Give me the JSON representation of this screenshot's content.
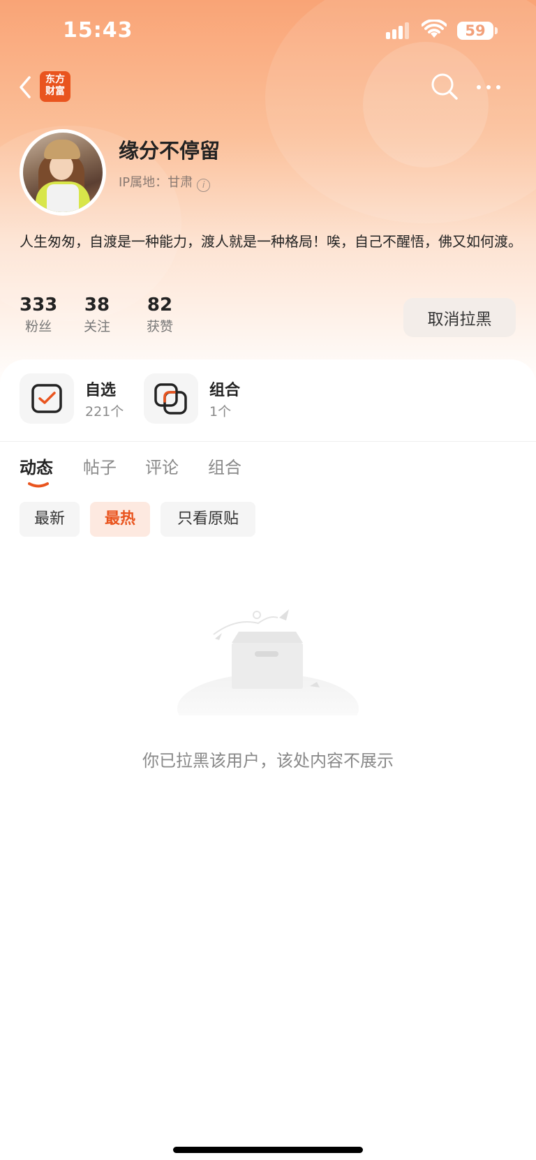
{
  "status_bar": {
    "time": "15:43",
    "battery": "59"
  },
  "nav": {
    "logo_line1": "东方",
    "logo_line2": "财富"
  },
  "profile": {
    "name": "缘分不停留",
    "ip_location": "IP属地：甘肃",
    "bio": "人生匆匆，自渡是一种能力，渡人就是一种格局！唉，自己不醒悟，佛又如何渡。"
  },
  "stats": [
    {
      "value": "333",
      "label": "粉丝"
    },
    {
      "value": "38",
      "label": "关注"
    },
    {
      "value": "82",
      "label": "获赞"
    }
  ],
  "actions": {
    "unblock_label": "取消拉黑"
  },
  "quick": [
    {
      "title": "自选",
      "sub": "221个",
      "icon": "checkbox-icon"
    },
    {
      "title": "组合",
      "sub": "1个",
      "icon": "portfolio-icon"
    }
  ],
  "tabs": [
    "动态",
    "帖子",
    "评论",
    "组合"
  ],
  "active_tab": "动态",
  "filters": [
    "最新",
    "最热",
    "只看原贴"
  ],
  "active_filter": "最热",
  "empty_state": {
    "message": "你已拉黑该用户，该处内容不展示"
  },
  "colors": {
    "accent": "#e9541e",
    "header_gradient_top": "#f9a476"
  }
}
